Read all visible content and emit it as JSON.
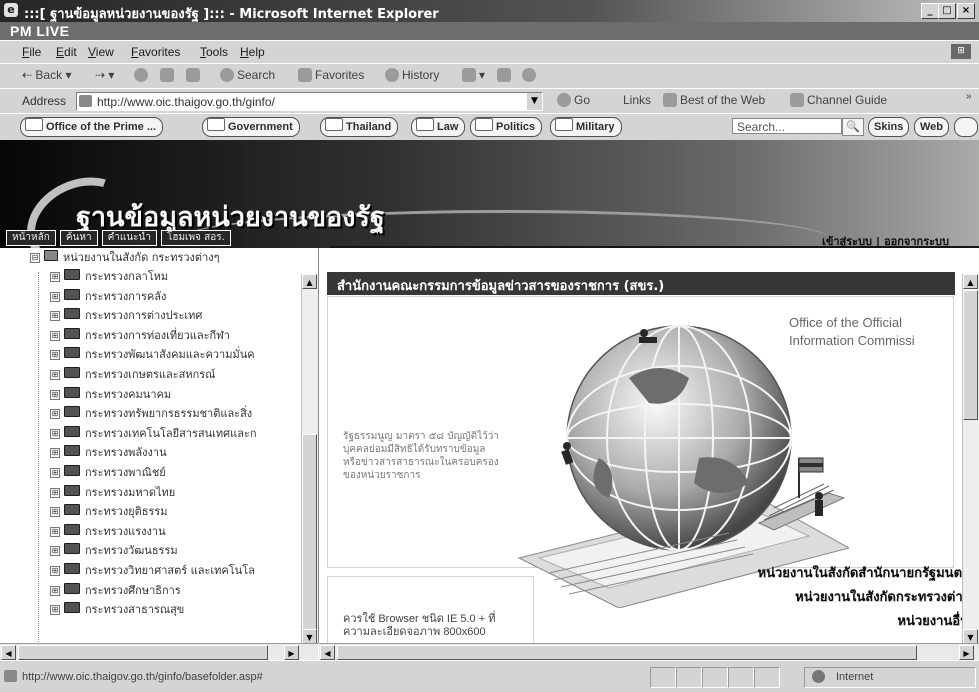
{
  "window": {
    "title": ":::[ ฐานข้อมูลหน่วยงานของรัฐ ]::: - Microsoft Internet Explorer",
    "minimize": "_",
    "maximize": "□",
    "close": "×"
  },
  "brand_band": {
    "label": "PM LIVE"
  },
  "menu": {
    "items": [
      "File",
      "Edit",
      "View",
      "Favorites",
      "Tools",
      "Help"
    ],
    "flag": "⊞"
  },
  "toolbar": {
    "back": "Back",
    "back_arrow": "⇠",
    "back_caret": "▾",
    "forward_arrow": "⇢",
    "forward_caret": "▾",
    "search": "Search",
    "favorites": "Favorites",
    "history": "History",
    "mail_caret": "▾"
  },
  "address": {
    "label": "Address",
    "value": "http://www.oic.thaigov.go.th/ginfo/",
    "dropdown": "▼",
    "go": "Go",
    "links_label": "Links",
    "link_items": [
      "Best of the Web",
      "Channel Guide"
    ],
    "overflow": "»"
  },
  "linkbar": {
    "buttons": [
      "Office of the Prime ...",
      "Government",
      "Thailand",
      "Law",
      "Politics",
      "Military"
    ],
    "search_placeholder": "Search...",
    "search_icon": "🔍",
    "skins": "Skins",
    "web": "Web"
  },
  "banner": {
    "title": "ฐานข้อมูลหน่วยงานของรัฐ",
    "nav_tabs": [
      "หน้าหลัก",
      "ค้นหา",
      "คำแนะนำ",
      "โฮมเพจ สอร."
    ],
    "login": "เข้าสู่ระบบ",
    "separator": "|",
    "logout": "ออกจากระบบ"
  },
  "tree": {
    "root": "หน่วยงานในสังกัด กระทรวงต่างๆ",
    "root_toggle": "⊟",
    "child_toggle": "⊞",
    "items": [
      "กระทรวงกลาโหม",
      "กระทรวงการคลัง",
      "กระทรวงการต่างประเทศ",
      "กระทรวงการท่องเที่ยวและกีฬา",
      "กระทรวงพัฒนาสังคมและความมั่นค",
      "กระทรวงเกษตรและสหกรณ์",
      "กระทรวงคมนาคม",
      "กระทรวงทรัพยากรธรรมชาติและสิ่ง",
      "กระทรวงเทคโนโลยีสารสนเทศและก",
      "กระทรวงพลังงาน",
      "กระทรวงพาณิชย์",
      "กระทรวงมหาดไทย",
      "กระทรวงยุติธรรม",
      "กระทรวงแรงงาน",
      "กระทรวงวัฒนธรรม",
      "กระทรวงวิทยาศาสตร์ และเทคโนโล",
      "กระทรวงศึกษาธิการ",
      "กระทรวงสาธารณสุข"
    ]
  },
  "content": {
    "header": "สำนักงานคณะกรรมการข้อมูลข่าวสารของราชการ (สขร.)",
    "english_name_line1": "Office of the Official",
    "english_name_line2": "Information Commissi",
    "constitution_text": "รัฐธรรมนูญ มาตรา ๕๘ บัญญัติไว้ว่า บุคคลย่อมมีสิทธิได้รับทราบข้อมูลหรือข่าวสารสาธารณะในครอบครองของหน่วยราชการ",
    "ie_note": "ควรใช้ Browser ชนิด IE 5.0 + ที่ความละเอียดจอภาพ 800x600",
    "agency_links": [
      "หน่วยงานในสังกัดสำนักนายกรัฐมนตร",
      "หน่วยงานในสังกัดกระทรวงต่าง",
      "หน่วยงานอื่น"
    ]
  },
  "scroll": {
    "up": "▲",
    "down": "▼",
    "left": "◀",
    "right": "▶"
  },
  "status": {
    "text": "http://www.oic.thaigov.go.th/ginfo/basefolder.asp#",
    "zone": "Internet"
  }
}
